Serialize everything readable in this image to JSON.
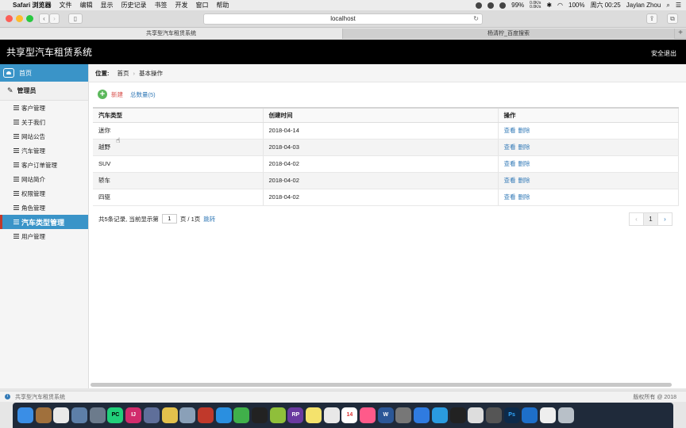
{
  "menubar": {
    "app_name": "Safari 浏览器",
    "items": [
      "文件",
      "编辑",
      "显示",
      "历史记录",
      "书签",
      "开发",
      "窗口",
      "帮助"
    ],
    "battery": "99%",
    "net_up": "0.0K/s",
    "net_down": "0.0K/s",
    "volume_pct": "100%",
    "clock": "周六 00:25",
    "user": "Jaylan Zhou"
  },
  "browser": {
    "address": "localhost",
    "tabs": [
      {
        "label": "共享型汽车租赁系统",
        "active": true
      },
      {
        "label": "杨清柠_百度搜索",
        "active": false
      }
    ]
  },
  "header": {
    "title": "共享型汽车租赁系统",
    "logout": "安全退出"
  },
  "sidebar": {
    "home": "首页",
    "group": "管理员",
    "items": [
      {
        "label": "客户管理",
        "active": false
      },
      {
        "label": "关于我们",
        "active": false
      },
      {
        "label": "网站公告",
        "active": false
      },
      {
        "label": "汽车管理",
        "active": false
      },
      {
        "label": "客户订单管理",
        "active": false
      },
      {
        "label": "网站简介",
        "active": false
      },
      {
        "label": "权限管理",
        "active": false
      },
      {
        "label": "角色管理",
        "active": false
      },
      {
        "label": "汽车类型管理",
        "active": true
      },
      {
        "label": "用户管理",
        "active": false
      }
    ]
  },
  "breadcrumb": {
    "label": "位置:",
    "home": "首页",
    "separator": "›",
    "current": "基本操作"
  },
  "actions": {
    "new_label": "新建",
    "total_label": "总数量(5)"
  },
  "table": {
    "columns": [
      "汽车类型",
      "创建时间",
      "操作"
    ],
    "rows": [
      {
        "type": "迷你",
        "created": "2018-04-14",
        "view": "查看",
        "delete": "删除"
      },
      {
        "type": "越野",
        "created": "2018-04-03",
        "view": "查看",
        "delete": "删除"
      },
      {
        "type": "SUV",
        "created": "2018-04-02",
        "view": "查看",
        "delete": "删除"
      },
      {
        "type": "轿车",
        "created": "2018-04-02",
        "view": "查看",
        "delete": "删除"
      },
      {
        "type": "四驱",
        "created": "2018-04-02",
        "view": "查看",
        "delete": "删除"
      }
    ]
  },
  "pagination": {
    "prefix": "共5条记录, 当前显示第",
    "page_value": "1",
    "suffix": "页 / 1页",
    "jump": "跳转",
    "prev": "‹",
    "current": "1",
    "next": "›"
  },
  "footer": {
    "left": "共享型汽车租赁系统",
    "right": "版权所有 @ 2018"
  },
  "colors": {
    "accent": "#3a94c8",
    "header_bg": "#000000",
    "link": "#337ab7",
    "new_button": "#d9534f"
  }
}
